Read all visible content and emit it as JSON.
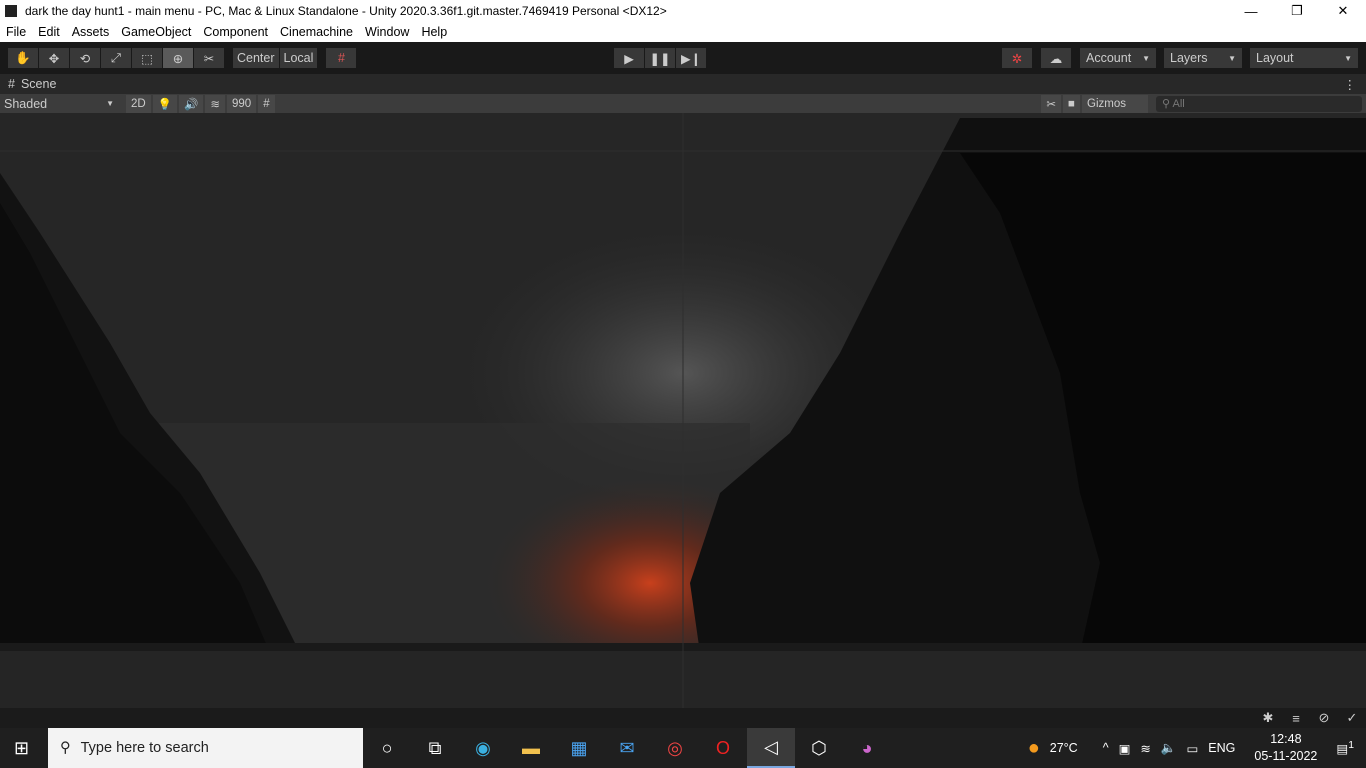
{
  "window": {
    "title": "dark the day hunt1 - main menu - PC, Mac & Linux Standalone - Unity 2020.3.36f1.git.master.7469419 Personal <DX12>",
    "minimize": "—",
    "maximize": "❐",
    "close": "✕"
  },
  "menu": [
    "File",
    "Edit",
    "Assets",
    "GameObject",
    "Component",
    "Cinemachine",
    "Window",
    "Help"
  ],
  "toolbar": {
    "tools": [
      "✋",
      "✥",
      "⟲",
      "⤢",
      "⬚",
      "⊕",
      "✂"
    ],
    "center": "Center",
    "local": "Local",
    "snap": "#",
    "play": "▶",
    "pause": "❚❚",
    "step": "▶❙",
    "collab": "✲",
    "cloud": "☁",
    "account": "Account",
    "layers": "Layers",
    "layout": "Layout"
  },
  "scene_tab": {
    "label": "Scene",
    "more": "⋮"
  },
  "scene_bar": {
    "shading": "Shaded",
    "mode_2d": "2D",
    "light": "💡",
    "audio": "🔊",
    "effects": "≋",
    "hidden": "990",
    "grid": "#",
    "tools": "✂",
    "camera": "■",
    "gizmos": "Gizmos",
    "search_placeholder": "All"
  },
  "status_icons": [
    "✱",
    "≡",
    "⊘",
    "✓"
  ],
  "taskbar": {
    "search_placeholder": "Type here to search",
    "temperature": "27°C",
    "language": "ENG",
    "time": "12:48",
    "date": "05-11-2022",
    "notifications": "1"
  }
}
